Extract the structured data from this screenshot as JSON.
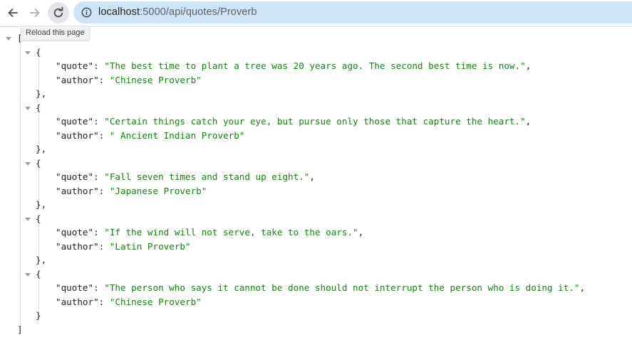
{
  "browser": {
    "url_host": "localhost",
    "url_path": ":5000/api/quotes/Proverb",
    "reload_tooltip": "Reload this page"
  },
  "json_viewer": {
    "items": [
      {
        "quote": "The best time to plant a tree was 20 years ago. The second best time is now.",
        "author": "Chinese Proverb"
      },
      {
        "quote": "Certain things catch your eye, but pursue only those that capture the heart.",
        "author": " Ancient Indian Proverb"
      },
      {
        "quote": "Fall seven times and stand up eight.",
        "author": "Japanese Proverb"
      },
      {
        "quote": "If the wind will not serve, take to the oars.",
        "author": "Latin Proverb"
      },
      {
        "quote": "The person who says it cannot be done should not interrupt the person who is doing it.",
        "author": "Chinese Proverb"
      }
    ]
  },
  "colors": {
    "string": "#1a7d1a",
    "key": "#1f1f1f",
    "omnibox": "#cfe4f6"
  }
}
